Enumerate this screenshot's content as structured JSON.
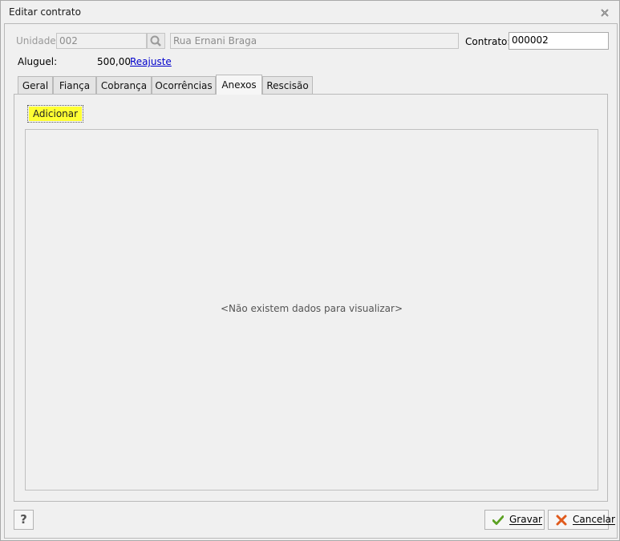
{
  "window": {
    "title": "Editar contrato"
  },
  "header": {
    "unidade_label": "Unidade:",
    "unidade_value": "002",
    "address_value": "Rua Ernani Braga",
    "contrato_label": "Contrato:",
    "contrato_value": "000002",
    "aluguel_label": "Aluguel:",
    "aluguel_value": "500,00",
    "reajuste_link": "Reajuste"
  },
  "tabs": [
    {
      "label": "Geral"
    },
    {
      "label": "Fiança"
    },
    {
      "label": "Cobrança"
    },
    {
      "label": "Ocorrências"
    },
    {
      "label": "Anexos",
      "selected": true
    },
    {
      "label": "Rescisão"
    }
  ],
  "anexos": {
    "add_button": "Adicionar",
    "empty_message": "<Não existem dados para visualizar>"
  },
  "footer": {
    "help_label": "?",
    "save_label": "Gravar",
    "cancel_label": "Cancelar"
  },
  "colors": {
    "highlight": "#ffff33",
    "link": "#0000cc",
    "save_icon": "#5aa021",
    "cancel_icon": "#e05a1c"
  }
}
